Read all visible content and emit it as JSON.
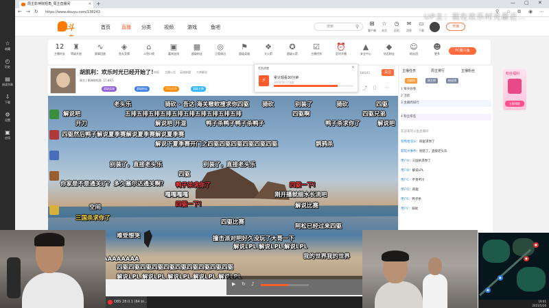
{
  "browser": {
    "tab_title": "周主影神院短角_周主直播间",
    "url": "https://www.douyu.com/138243",
    "new_tab": "+"
  },
  "sidebar": {
    "items": [
      {
        "icon": "☆",
        "label": "收藏"
      },
      {
        "icon": "◴",
        "label": "历史"
      },
      {
        "icon": "▤",
        "label": "阅读列表"
      },
      {
        "icon": "⇩",
        "label": "下载"
      },
      {
        "icon": "⚙",
        "label": "设置"
      },
      {
        "icon": "▣",
        "label": "应用"
      }
    ]
  },
  "header": {
    "logo": "斗鱼",
    "nav": [
      "首页",
      "直播",
      "分类",
      "视频",
      "游戏",
      "鱼吧"
    ],
    "active_nav": "直播",
    "search_placeholder": "搜索",
    "icons": [
      {
        "g": "⊞",
        "l": "客户端"
      },
      {
        "g": "☆",
        "l": "关注"
      },
      {
        "g": "◷",
        "l": "历史"
      },
      {
        "g": "✉",
        "l": "消息"
      },
      {
        "g": "▭",
        "l": "下载"
      }
    ],
    "open_live": "开播"
  },
  "activity_bar": {
    "count": "12",
    "count_label": "主播时长",
    "items": [
      {
        "g": "♜",
        "l": "等级开放"
      },
      {
        "g": "∿",
        "l": "赛事回放"
      },
      {
        "g": "◈",
        "l": "鱼丸竞猜"
      },
      {
        "g": "⌂",
        "l": "斗鱼口袋"
      },
      {
        "g": "▣",
        "l": "嘉宾连线"
      },
      {
        "g": "▦",
        "l": "超级粉丝"
      },
      {
        "g": "◎",
        "l": "正版周边"
      },
      {
        "g": "⚑",
        "l": "超级英雄"
      },
      {
        "g": "❖",
        "l": "大火箭"
      },
      {
        "g": "✪",
        "l": "超级火箭"
      },
      {
        "g": "☑",
        "l": "主播任务"
      },
      {
        "g": "⏰",
        "l": "定时开播"
      },
      {
        "g": "▲",
        "l": "安全中心"
      },
      {
        "g": "◆",
        "l": "钻石粉丝"
      },
      {
        "g": "☺",
        "l": "粉丝团"
      },
      {
        "g": "☻",
        "l": "更多"
      }
    ],
    "pc_button": "PC版斗鱼"
  },
  "streamer": {
    "title": "胡凯利：欢乐时光已经开始了！",
    "meta": [
      "举报",
      "主播公告",
      "英雄联盟",
      "大神解说"
    ],
    "line2": "周主 | 影神院短角",
    "viewers": "17.88万",
    "badges": [
      {
        "text": "超级英雄",
        "color": "#8e5bd9"
      },
      {
        "text": "超级粉丝",
        "color": "#3b7de3"
      },
      {
        "text": "10分分享",
        "color": "#ff8a00"
      },
      {
        "text": "超级主播",
        "color": "#2bb3ff"
      }
    ],
    "follow_label": "关注",
    "follower_count": "189241",
    "hot_label": "热度"
  },
  "task_popup": {
    "title": "任务进度",
    "description": "累计观看30分钟",
    "sub": "3000/30 已领取",
    "progress": 0.8
  },
  "danmaku": [
    {
      "t": "老头乐",
      "c": "w"
    },
    {
      "t": "骑砍 - 吾达 海关嗷欸搜求你四驱",
      "c": "w"
    },
    {
      "t": "骑砍",
      "c": "w"
    },
    {
      "t": "别装了",
      "c": "w"
    },
    {
      "t": "骑砍",
      "c": "w"
    },
    {
      "t": "四驱",
      "c": "w"
    },
    {
      "t": "解说吧",
      "c": "w"
    },
    {
      "t": "五排五排五排五排五排五排五排五排五排五排",
      "c": "w"
    },
    {
      "t": "四驱啊",
      "c": "w"
    },
    {
      "t": "四驱兄弟",
      "c": "w"
    },
    {
      "t": "开刀",
      "c": "w"
    },
    {
      "t": "解说吧 开混",
      "c": "w"
    },
    {
      "t": "鸭子杀鸭子鸭子杀鸭子",
      "c": "w"
    },
    {
      "t": "鸭子杀求你了",
      "c": "w"
    },
    {
      "t": "解说吧",
      "c": "w"
    },
    {
      "t": "四驱然后鸭子解说夏季赛解说夏季赛解说夏季赛",
      "c": "w"
    },
    {
      "t": "解说下夏季赛开门之四驱四驱四驱四驱四驱四驱",
      "c": "w"
    },
    {
      "t": "鹊鸦杀",
      "c": "w"
    },
    {
      "t": "别装了，直接老头乐",
      "c": "w"
    },
    {
      "t": "别装了，直接老头乐",
      "c": "w"
    },
    {
      "t": "四驱",
      "c": "w"
    },
    {
      "t": "你家是不是通关了？",
      "c": "w"
    },
    {
      "t": "多久塞尔达通关啊？",
      "c": "w"
    },
    {
      "t": "嘎嘎嘎嘎",
      "c": "w"
    },
    {
      "t": "鸭子杀求你了",
      "c": "r"
    },
    {
      "t": "四驱一下！",
      "c": "r"
    },
    {
      "t": "四驱一下！",
      "c": "r"
    },
    {
      "t": "刚开播就细水长流吧",
      "c": "w"
    },
    {
      "t": "解说比赛",
      "c": "w"
    },
    {
      "t": "三国杀求你了",
      "c": "y"
    },
    {
      "t": "四驱比赛",
      "c": "w"
    },
    {
      "t": "空间",
      "c": "w"
    },
    {
      "t": "阿松已经过来四驱",
      "c": "w"
    },
    {
      "t": "难受想哭",
      "c": "w"
    },
    {
      "t": "撞击派对吧好久没玩了大哥一下",
      "c": "w"
    },
    {
      "t": "解说LPL 解说LPL 解说LPL",
      "c": "w"
    },
    {
      "t": "AAAAAAAA",
      "c": "w"
    },
    {
      "t": "我的世界我的世界",
      "c": "w"
    },
    {
      "t": "四驱四驱四驱四驱四驱四驱四驱四驱四驱四驱",
      "c": "w"
    },
    {
      "t": "解说LPL 解说LPL 解说LPL 解说LPL 解说LPL",
      "c": "w"
    }
  ],
  "right_panel": {
    "tabs": [
      "主播任务",
      "周主排行",
      "主播粉丝"
    ],
    "rank_header": [
      "贡献榜",
      "周主榜",
      "粉丝榜"
    ],
    "rows": [
      "1 每天收看",
      "2 活跃",
      "3 主播周排行",
      "4 粉丝排名"
    ],
    "announce": "欢迎来到斗鱼直播间",
    "gift": {
      "title": "粉丝福利",
      "button": "立即领取"
    },
    "chat": [
      {
        "n": "狗熊哈流斗",
        "m": "：四驱求你了"
      },
      {
        "n": "影院大事件",
        "m": "：别装了，直接老头乐"
      },
      {
        "n": "用户A",
        "m": "：三国杀求你了"
      },
      {
        "n": "用户B",
        "m": "：解说LPL"
      },
      {
        "n": "用户C",
        "m": "：不贵不冷"
      },
      {
        "n": "用户D",
        "m": "：四驱"
      },
      {
        "n": "用户E",
        "m": "：鸭子杀"
      },
      {
        "n": "用户F",
        "m": "：骑砍"
      }
    ]
  },
  "taskbar": {
    "app": "OBS 28.0.1 (64 bi..."
  },
  "tray": {
    "time": "19:01",
    "date": "2021/5/26"
  },
  "watermark": "UP主：我在欢乐时光最近…"
}
